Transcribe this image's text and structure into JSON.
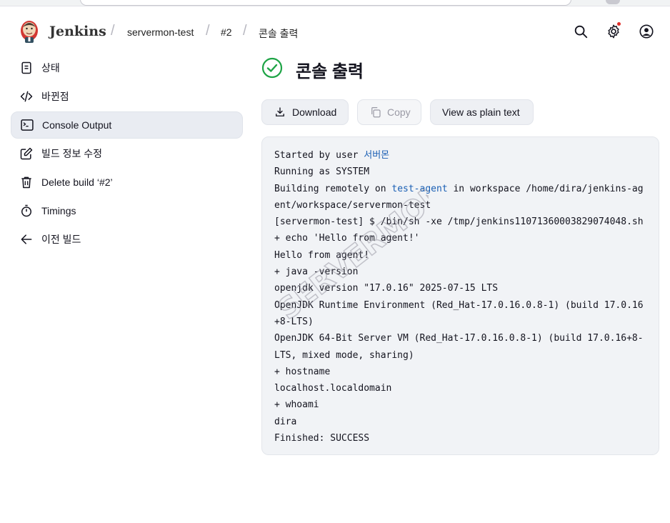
{
  "header": {
    "brand": "Jenkins",
    "breadcrumbs": [
      "servermon-test",
      "#2",
      "콘솔 출력"
    ]
  },
  "sidebar": {
    "items": [
      {
        "label": "상태",
        "icon": "status-document-icon"
      },
      {
        "label": "바뀐점",
        "icon": "code-changes-icon"
      },
      {
        "label": "Console Output",
        "icon": "terminal-icon",
        "active": true
      },
      {
        "label": "빌드 정보 수정",
        "icon": "edit-icon"
      },
      {
        "label": "Delete build ‘#2’",
        "icon": "trash-icon"
      },
      {
        "label": "Timings",
        "icon": "stopwatch-icon"
      },
      {
        "label": "이전 빌드",
        "icon": "arrow-left-icon"
      }
    ]
  },
  "main": {
    "title": "콘솔 출력",
    "status_icon": "success-check-icon",
    "buttons": {
      "download": "Download",
      "copy": "Copy",
      "plain_text": "View as plain text"
    }
  },
  "console": {
    "lines": [
      {
        "prefix": "Started by user ",
        "link": "서버몬",
        "suffix": ""
      },
      {
        "prefix": "Running as SYSTEM",
        "link": "",
        "suffix": ""
      },
      {
        "prefix": "Building remotely on ",
        "link": "test-agent",
        "suffix": " in workspace /home/dira/jenkins-agent/workspace/servermon-test"
      },
      {
        "prefix": "[servermon-test] $ /bin/sh -xe /tmp/jenkins11071360003829074048.sh",
        "link": "",
        "suffix": ""
      },
      {
        "prefix": "+ echo 'Hello from agent!'",
        "link": "",
        "suffix": ""
      },
      {
        "prefix": "Hello from agent!",
        "link": "",
        "suffix": ""
      },
      {
        "prefix": "+ java -version",
        "link": "",
        "suffix": ""
      },
      {
        "prefix": "openjdk version \"17.0.16\" 2025-07-15 LTS",
        "link": "",
        "suffix": ""
      },
      {
        "prefix": "OpenJDK Runtime Environment (Red_Hat-17.0.16.0.8-1) (build 17.0.16+8-LTS)",
        "link": "",
        "suffix": ""
      },
      {
        "prefix": "OpenJDK 64-Bit Server VM (Red_Hat-17.0.16.0.8-1) (build 17.0.16+8-LTS, mixed mode, sharing)",
        "link": "",
        "suffix": ""
      },
      {
        "prefix": "+ hostname",
        "link": "",
        "suffix": ""
      },
      {
        "prefix": "localhost.localdomain",
        "link": "",
        "suffix": ""
      },
      {
        "prefix": "+ whoami",
        "link": "",
        "suffix": ""
      },
      {
        "prefix": "dira",
        "link": "",
        "suffix": ""
      },
      {
        "prefix": "Finished: SUCCESS",
        "link": "",
        "suffix": ""
      }
    ]
  },
  "watermark": {
    "text": "SERVERMON"
  },
  "colors": {
    "success": "#1ea446",
    "link": "#1a5fb4",
    "accent_dot": "#e0302a"
  }
}
